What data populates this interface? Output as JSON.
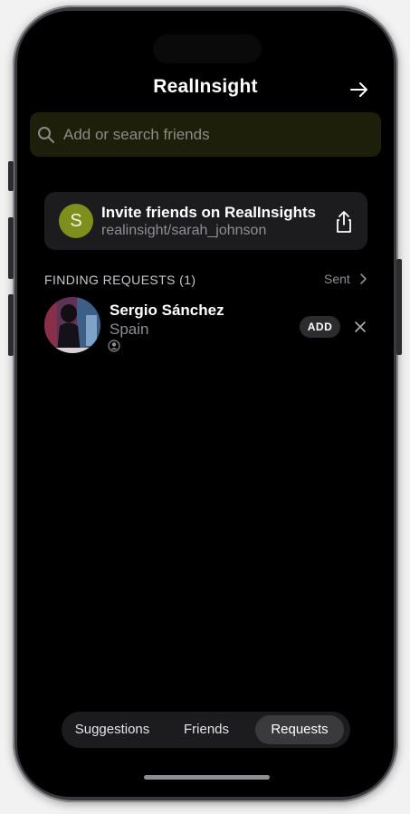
{
  "header": {
    "title": "RealInsight"
  },
  "search": {
    "placeholder": "Add or search friends"
  },
  "invite": {
    "avatar_letter": "S",
    "title": "Invite friends on RealInsights",
    "subtitle": "realinsight/sarah_johnson"
  },
  "requests": {
    "section_label": "FINDING REQUESTS (1)",
    "sent_label": "Sent",
    "items": [
      {
        "name": "Sergio Sánchez",
        "country": "Spain",
        "add_label": "ADD"
      }
    ]
  },
  "tabs": [
    {
      "label": "Suggestions",
      "active": false
    },
    {
      "label": "Friends",
      "active": false
    },
    {
      "label": "Requests",
      "active": true
    }
  ],
  "colors": {
    "background": "#000000",
    "search_bg": "#1d1f0b",
    "card_bg": "#1c1c1e",
    "avatar_accent": "#7f8f1c"
  }
}
